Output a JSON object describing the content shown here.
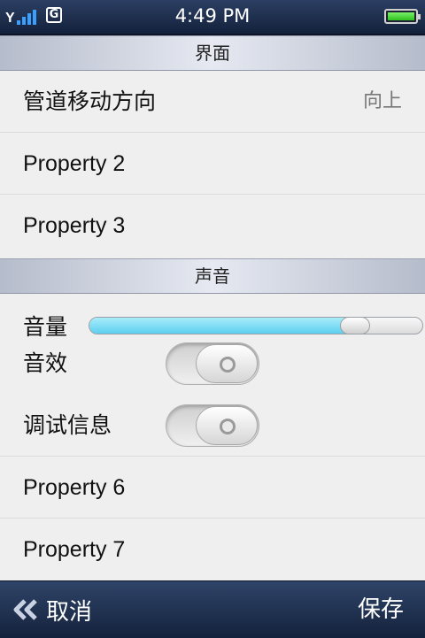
{
  "status_bar": {
    "time": "4:49 PM",
    "network_letter": "G",
    "icons": [
      "signal-icon",
      "network-g-icon",
      "battery-icon"
    ]
  },
  "sections": {
    "interface": {
      "title": "界面"
    },
    "sound": {
      "title": "声音"
    }
  },
  "rows": {
    "pipe_direction": {
      "label": "管道移动方向",
      "value": "向上"
    },
    "property2": {
      "label": "Property 2"
    },
    "property3": {
      "label": "Property 3"
    },
    "volume": {
      "label": "音量",
      "level": 0.78
    },
    "sound_effects": {
      "label": "音效",
      "state": "off"
    },
    "debug_info": {
      "label": "调试信息",
      "state": "off"
    },
    "property6": {
      "label": "Property 6"
    },
    "property7": {
      "label": "Property 7"
    }
  },
  "bottom_bar": {
    "cancel_label": "取消",
    "save_label": "保存"
  },
  "colors": {
    "accent_fill": "#5dd0ef",
    "bar_dark": "#14223c",
    "battery_green": "#2ec01e"
  }
}
